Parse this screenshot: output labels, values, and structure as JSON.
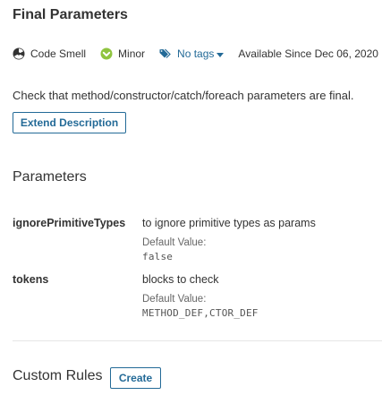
{
  "rule": {
    "title": "Final Parameters",
    "meta": {
      "type": {
        "label": "Code Smell",
        "icon": "code-smell-icon"
      },
      "severity": {
        "label": "Minor",
        "icon": "minor-severity-icon",
        "color": "#8fc43f"
      },
      "tags": {
        "label": "No tags",
        "icon": "tag-icon",
        "color": "#236a97"
      },
      "since": "Available Since Dec 06, 2020"
    },
    "description": "Check that method/constructor/catch/foreach parameters are final.",
    "extend_button": "Extend Description"
  },
  "parameters": {
    "title": "Parameters",
    "items": [
      {
        "name": "ignorePrimitiveTypes",
        "description": "to ignore primitive types as params",
        "default_label": "Default Value:",
        "default_value": "false"
      },
      {
        "name": "tokens",
        "description": "blocks to check",
        "default_label": "Default Value:",
        "default_value": "METHOD_DEF,CTOR_DEF"
      }
    ]
  },
  "custom_rules": {
    "title": "Custom Rules",
    "create_button": "Create"
  },
  "colors": {
    "link": "#236a97",
    "text": "#333333",
    "muted": "#666666"
  }
}
